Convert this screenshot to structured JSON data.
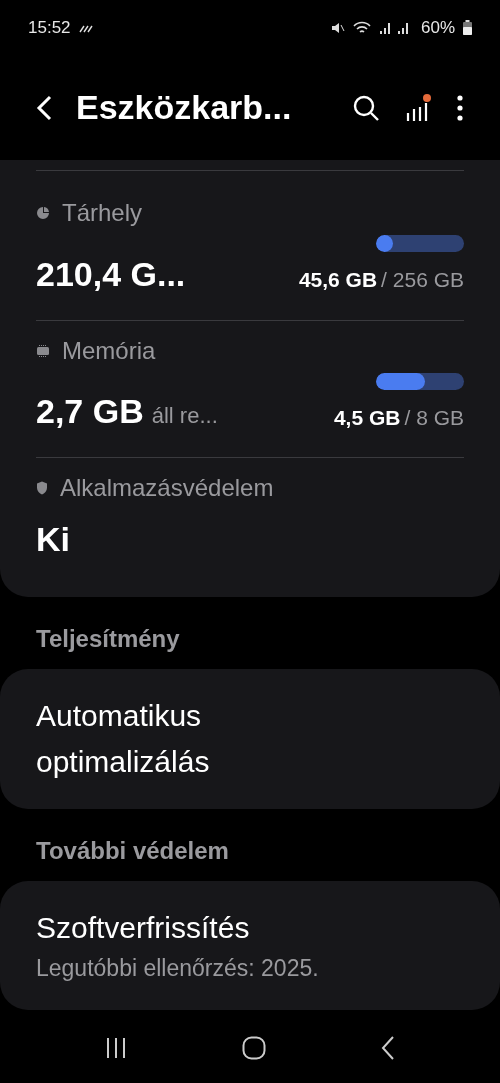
{
  "status_bar": {
    "time": "15:52",
    "battery": "60%"
  },
  "header": {
    "title": "Eszközkarb..."
  },
  "status_card": {
    "rows": [
      {
        "kind": "meter",
        "label": "Tárhely",
        "value": "210,4 G...",
        "used": "45,6 GB",
        "total": "/ 256 GB",
        "level": 0.18
      },
      {
        "kind": "meter",
        "label": "Memória",
        "value": "2,7 GB",
        "value_note": "áll re...",
        "used": "4,5 GB",
        "total": "/ 8 GB",
        "level": 0.56
      },
      {
        "kind": "plain",
        "label": "Alkalmazásvédelem",
        "value": "Ki"
      }
    ]
  },
  "sections": [
    {
      "title": "Teljesítmény",
      "items": [
        {
          "title": "Automatikus optimalizálás"
        }
      ]
    },
    {
      "title": "További védelem",
      "items": [
        {
          "title": "Szoftverfrissítés",
          "subtitle": "Legutóbbi ellenőrzés: 2025."
        }
      ]
    }
  ]
}
